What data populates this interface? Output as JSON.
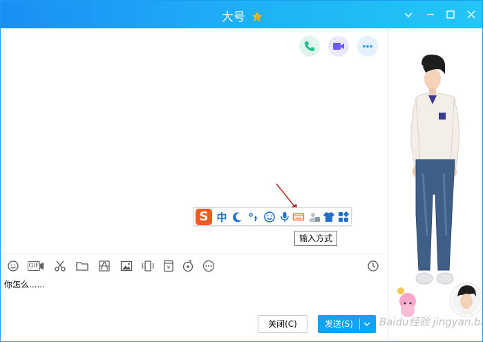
{
  "window": {
    "title": "大号",
    "accent": "#1a8ff5",
    "controls": [
      "settings-chevron",
      "minimize",
      "maximize",
      "close"
    ]
  },
  "chat_actions": [
    {
      "icon": "phone-icon",
      "color": "#1fbf8f"
    },
    {
      "icon": "video-icon",
      "color": "#6a5cf0"
    },
    {
      "icon": "more-icon",
      "color": "#1f9cf0"
    }
  ],
  "ime_toolbar": {
    "logo": "S",
    "mode": "中",
    "tooltip": "输入方式",
    "items": [
      "sogou-logo-icon",
      "chinese-mode-icon",
      "moon-icon",
      "punctuation-icon",
      "emoji-icon",
      "microphone-icon",
      "keyboard-icon",
      "user-card-icon",
      "shirt-icon",
      "grid-icon"
    ]
  },
  "toolbar": {
    "gif_label": "GIF",
    "items": [
      "emoji-icon",
      "gif-icon",
      "scissors-icon",
      "folder-icon",
      "image-edit-icon",
      "image-icon",
      "shake-icon",
      "red-packet-icon",
      "music-icon",
      "more-icon",
      "history-clock-icon"
    ]
  },
  "input": {
    "value": "你怎么......"
  },
  "buttons": {
    "close_label": "关闭(C)",
    "send_label": "发送(S)"
  },
  "watermark": "Baidu经验 jingyan.baidu.com"
}
